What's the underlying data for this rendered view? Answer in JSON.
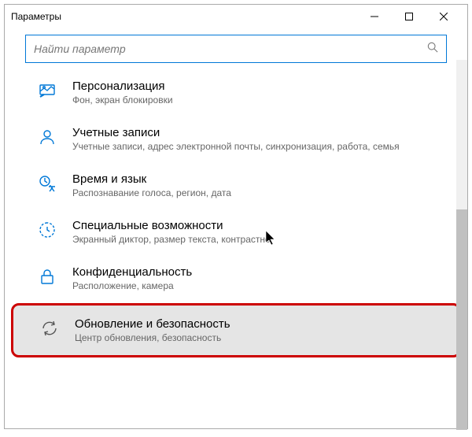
{
  "window": {
    "title": "Параметры"
  },
  "search": {
    "placeholder": "Найти параметр"
  },
  "categories": [
    {
      "title": "Персонализация",
      "desc": "Фон, экран блокировки"
    },
    {
      "title": "Учетные записи",
      "desc": "Учетные записи, адрес электронной почты, синхронизация, работа, семья"
    },
    {
      "title": "Время и язык",
      "desc": "Распознавание голоса, регион, дата"
    },
    {
      "title": "Специальные возможности",
      "desc": "Экранный диктор, размер текста, контрастно"
    },
    {
      "title": "Конфиденциальность",
      "desc": "Расположение, камера"
    },
    {
      "title": "Обновление и безопасность",
      "desc": "Центр обновления, безопасность"
    }
  ]
}
